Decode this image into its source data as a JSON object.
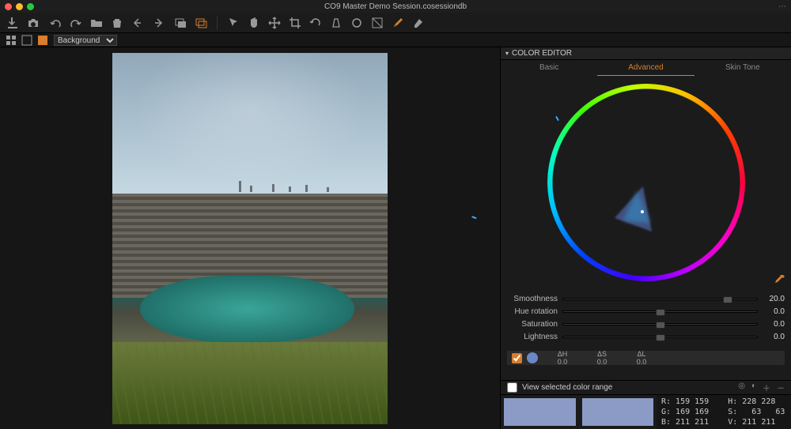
{
  "window": {
    "title": "CO9 Master Demo Session.cosessiondb"
  },
  "layer_select": {
    "value": "Background"
  },
  "panel": {
    "title": "COLOR EDITOR",
    "tabs": {
      "basic": "Basic",
      "advanced": "Advanced",
      "skintone": "Skin Tone",
      "active": 1
    }
  },
  "sliders": {
    "smoothness": {
      "label": "Smoothness",
      "value": "20.0",
      "pos": 85
    },
    "hue": {
      "label": "Hue rotation",
      "value": "0.0",
      "pos": 50
    },
    "saturation": {
      "label": "Saturation",
      "value": "0.0",
      "pos": 50
    },
    "lightness": {
      "label": "Lightness",
      "value": "0.0",
      "pos": 50
    }
  },
  "delta": {
    "h_label": "ΔH",
    "s_label": "ΔS",
    "l_label": "ΔL",
    "h": "0.0",
    "s": "0.0",
    "l": "0.0",
    "checked": true
  },
  "view_range": {
    "label": "View selected color range",
    "checked": false
  },
  "readout": {
    "r_label": "R:",
    "r": "159",
    "r2": "159",
    "h_label": "H:",
    "h": "228",
    "h2": "228",
    "g_label": "G:",
    "g": "169",
    "g2": "169",
    "s_label": "S:",
    "s": "63",
    "s2": "63",
    "b_label": "B:",
    "b": "211",
    "b2": "211",
    "v_label": "V:",
    "v": "211",
    "v2": "211"
  }
}
